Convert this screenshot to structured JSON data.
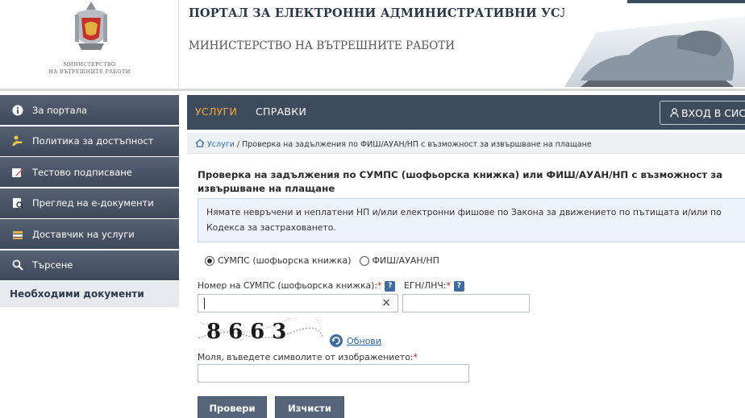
{
  "header": {
    "portal_title": "ПОРТАЛ ЗА ЕЛЕКТРОННИ АДМИНИСТРАТИВНИ УСЛУГИ",
    "ministry_title": "МИНИСТЕРСТВО НА ВЪТРЕШНИТЕ РАБОТИ",
    "logo_caption_line1": "Министерство",
    "logo_caption_line2": "на вътрешните работи"
  },
  "sidebar": {
    "items": [
      {
        "label": "За портала",
        "icon": "info-icon"
      },
      {
        "label": "Политика за достъпност",
        "icon": "accessibility-icon"
      },
      {
        "label": "Тестово подписване",
        "icon": "pencil-icon"
      },
      {
        "label": "Преглед на е-документи",
        "icon": "document-view-icon"
      },
      {
        "label": "Доставчик на услуги",
        "icon": "stack-icon"
      },
      {
        "label": "Търсене",
        "icon": "search-icon"
      }
    ],
    "plain_item": "Необходими документи"
  },
  "nav": {
    "services": "УСЛУГИ",
    "references": "СПРАВКИ",
    "login": "ВХОД В СИС"
  },
  "breadcrumb": {
    "home_link": "Услуги",
    "separator": " / ",
    "current": "Проверка на задължения по ФИШ/АУАН/НП с възможност за извършване на плащане"
  },
  "form": {
    "title": "Проверка на задължения по СУМПС (шофьорска книжка) или ФИШ/АУАН/НП с възможност за извършване на плащане",
    "info_text": "Нямате невръчени и неплатени НП и/или електронни фишове по Закона за движението по пътищата и/или по Кодекса за застраховането.",
    "radio_options": [
      {
        "label": "СУМПС (шофьорска книжка)",
        "selected": true
      },
      {
        "label": "ФИШ/АУАН/НП",
        "selected": false
      }
    ],
    "license_label": "Номер на СУМПС (шофьорска книжка):",
    "egn_label": "ЕГН/ЛНЧ:",
    "required_mark": "*",
    "help_mark": "?",
    "clear_mark": "×",
    "license_value": "",
    "egn_value": "",
    "captcha_code": "8663",
    "refresh_label": "Обнови",
    "captcha_prompt": "Моля, въведете символите от изображението:",
    "captcha_value": "",
    "check_button": "Провери",
    "clear_button": "Изчисти"
  },
  "colors": {
    "sidebar_bg": "#4a5666",
    "nav_bg": "#3e4b5c",
    "nav_active": "#f4a742",
    "link": "#2f6aa8",
    "required": "#d02020",
    "button_bg": "#56657a"
  }
}
